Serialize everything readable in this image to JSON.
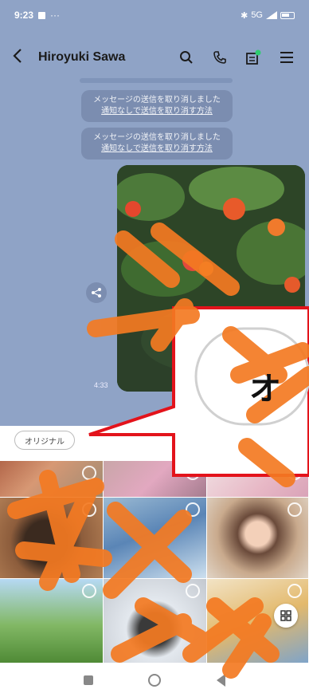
{
  "status_bar": {
    "time": "9:23",
    "dots": "···",
    "network": "5G"
  },
  "header": {
    "contact_name": "Hiroyuki Sawa"
  },
  "messages": [
    {
      "line1": "メッセージの送信を取り消しました",
      "link": "通知なしで送信を取り消す方法"
    },
    {
      "line1": "メッセージの送信を取り消しました",
      "link": "通知なしで送信を取り消す方法"
    }
  ],
  "photo_time": "4:33",
  "callout": {
    "text": "オ"
  },
  "picker": {
    "original_label": "オリジナル"
  },
  "colors": {
    "chat_bg": "#8fa3c6",
    "annotation_orange": "#f47a22",
    "callout_red": "#e3131b"
  }
}
